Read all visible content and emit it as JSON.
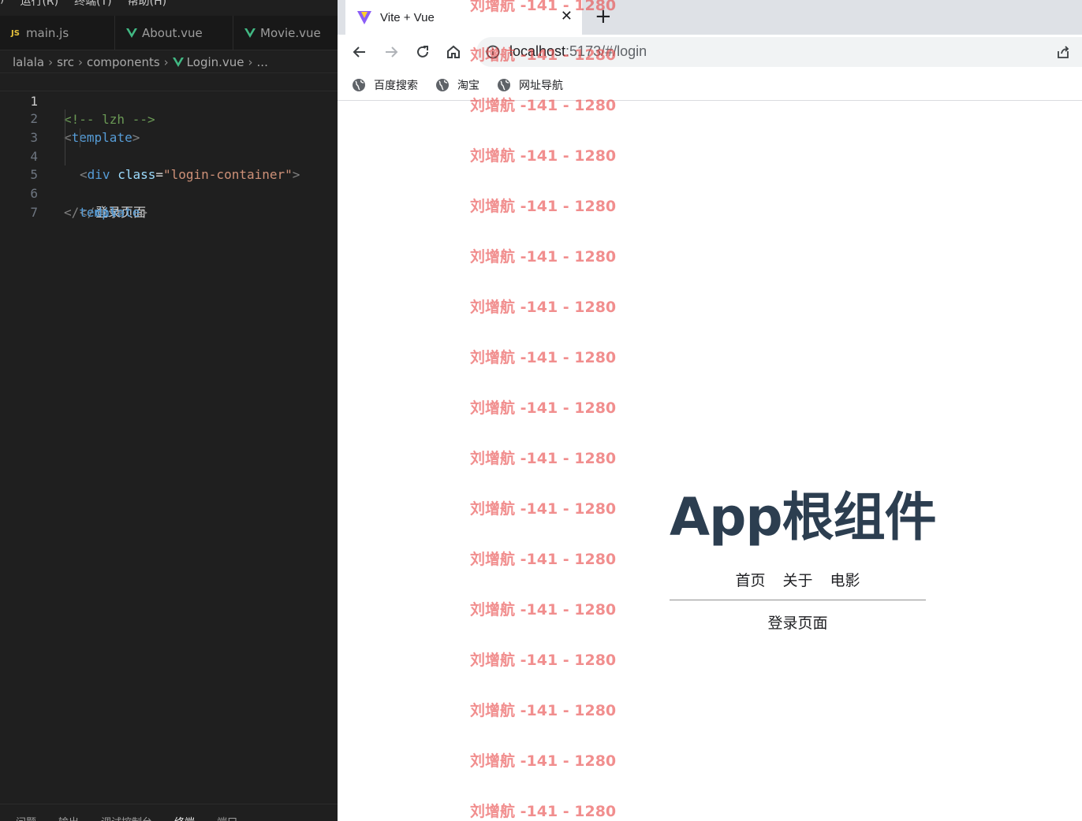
{
  "editor": {
    "menu": [
      ")",
      "运行(R)",
      "终端(T)",
      "帮助(H)"
    ],
    "tabs": [
      {
        "icon": "JS",
        "label": "main.js"
      },
      {
        "icon": "vue-icon",
        "label": "About.vue"
      },
      {
        "icon": "vue-icon",
        "label": "Movie.vue"
      }
    ],
    "breadcrumb": [
      "lalala",
      "src",
      "components",
      "Login.vue",
      "..."
    ],
    "line_numbers": [
      "1",
      "2",
      "3",
      "4",
      "5",
      "6",
      "7"
    ],
    "code": {
      "l1": "<!-- lzh -->",
      "l2_open": "<",
      "l2_tag": "template",
      "l2_close": ">",
      "l3_open": "<",
      "l3_tag": "div",
      "l3_attr": "class",
      "l3_eq": "=",
      "l3_str": "\"login-container\"",
      "l3_close": ">",
      "l4": "登录页面",
      "l5_open": "</",
      "l5_tag": "div",
      "l5_close": ">",
      "l6_open": "</",
      "l6_tag": "template",
      "l6_close": ">"
    },
    "panel_tabs": [
      "问题",
      "输出",
      "调试控制台",
      "终端",
      "端口"
    ],
    "colors": {
      "background": "#1f1f1f",
      "tag": "#569cd6",
      "string": "#ce9178",
      "comment": "#6a9955"
    }
  },
  "browser": {
    "tab_title": "Vite + Vue",
    "url_host": "localhost",
    "url_rest": ":5173/#/login",
    "bookmarks": [
      "百度搜索",
      "淘宝",
      "网址导航"
    ]
  },
  "page": {
    "title": "App根组件",
    "nav": [
      "首页",
      "关于",
      "电影"
    ],
    "view_text": "登录页面"
  },
  "watermark": {
    "text": "刘增航 -141 - 1280",
    "color": "#e84848"
  }
}
